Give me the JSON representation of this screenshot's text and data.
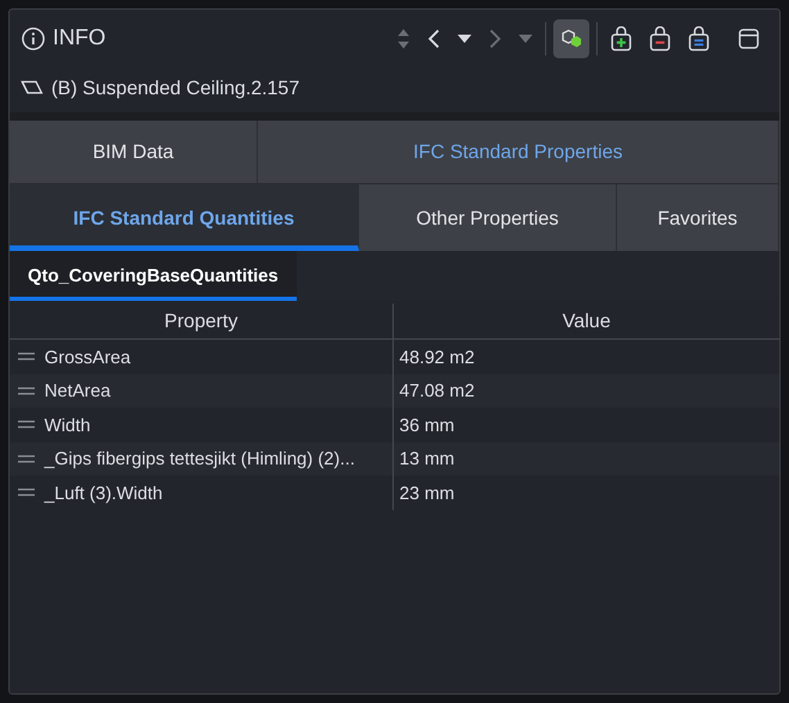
{
  "header": {
    "title": "INFO"
  },
  "toolbar": [
    {
      "kind": "sort",
      "disabled": true
    },
    {
      "kind": "back",
      "disabled": false
    },
    {
      "kind": "dropdown",
      "disabled": false
    },
    {
      "kind": "forward",
      "disabled": true
    },
    {
      "kind": "dropdown",
      "disabled": true
    },
    {
      "kind": "cube",
      "active": true
    },
    {
      "kind": "bag-add"
    },
    {
      "kind": "bag-remove"
    },
    {
      "kind": "bag-equal"
    },
    {
      "kind": "window"
    }
  ],
  "element": {
    "name": "(B) Suspended Ceiling.2.157"
  },
  "tabs_top": [
    {
      "label": "BIM Data",
      "selected": false
    },
    {
      "label": "IFC Standard Properties",
      "selected": true
    }
  ],
  "tabs_second": [
    {
      "label": "IFC Standard Quantities",
      "selected": true
    },
    {
      "label": "Other Properties",
      "selected": false
    },
    {
      "label": "Favorites",
      "selected": false
    }
  ],
  "subtabs": [
    {
      "label": "Qto_CoveringBaseQuantities",
      "selected": true
    }
  ],
  "table": {
    "columns": [
      "Property",
      "Value"
    ],
    "rows": [
      {
        "property": "GrossArea",
        "value": "48.92 m2"
      },
      {
        "property": "NetArea",
        "value": "47.08 m2"
      },
      {
        "property": "Width",
        "value": "36 mm"
      },
      {
        "property": "_Gips fibergips tettesjikt (Himling) (2)...",
        "value": "13 mm"
      },
      {
        "property": "_Luft (3).Width",
        "value": "23 mm"
      }
    ]
  }
}
